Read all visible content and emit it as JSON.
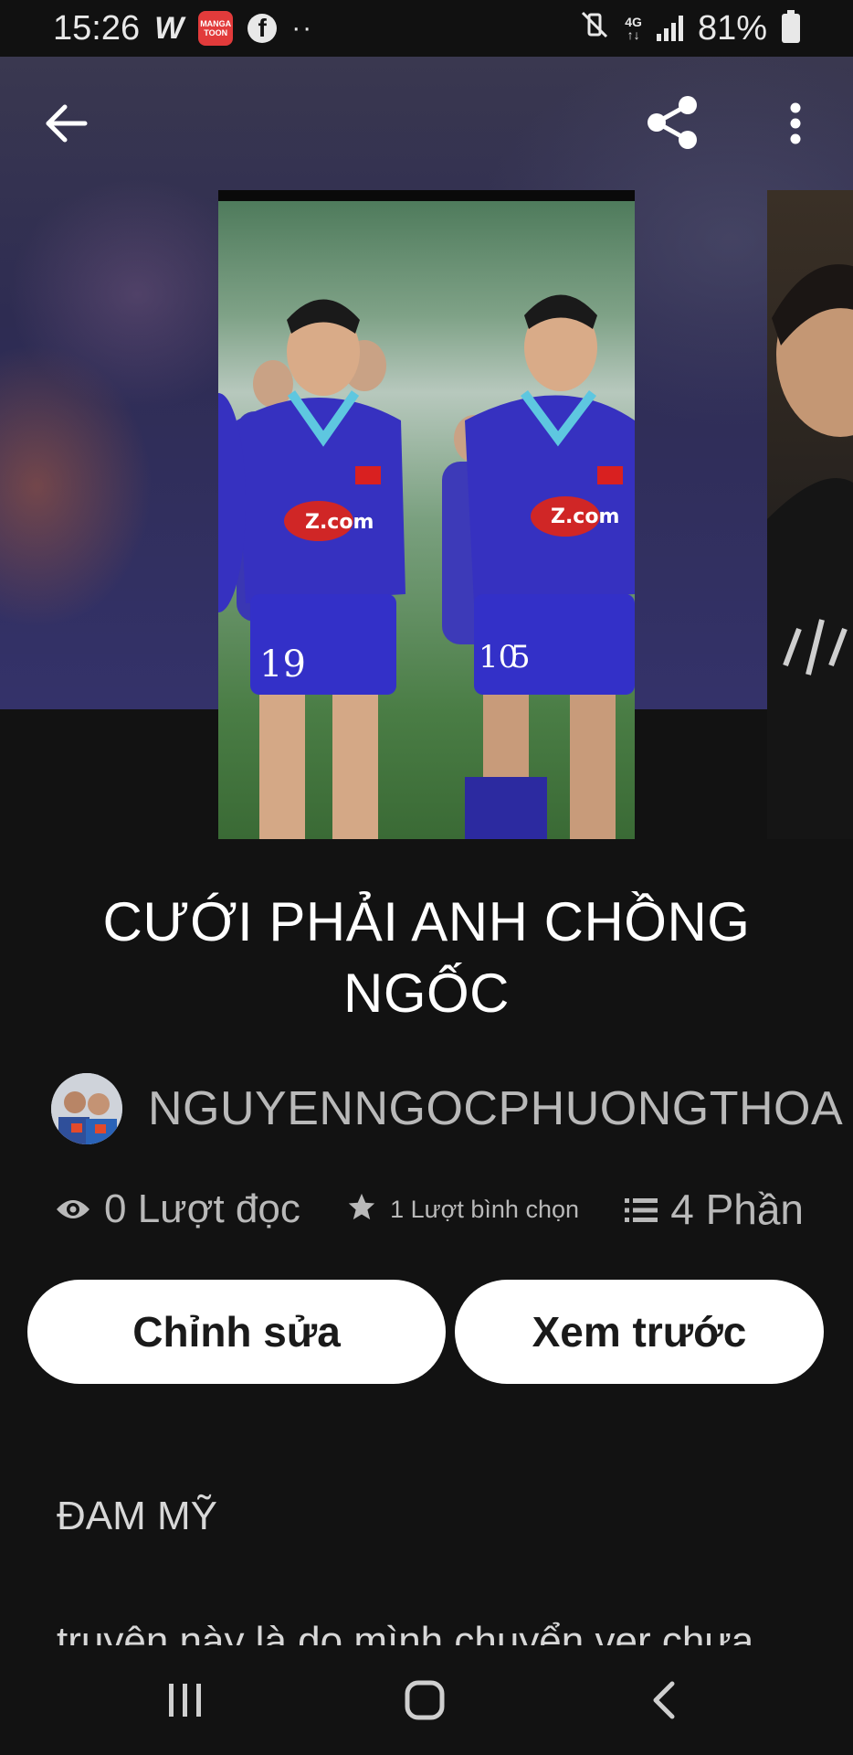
{
  "status_bar": {
    "time": "15:26",
    "app_w": "W",
    "manga_line1": "MANGA",
    "manga_line2": "TOON",
    "fb": "f",
    "dots": "··",
    "network_top": "4G",
    "network_bottom": "↑↓",
    "battery": "81%"
  },
  "story": {
    "title": "CƯỚI PHẢI ANH CHỒNG NGỐC",
    "author": "NGUYENNGOCPHUONGTHOA",
    "stats": {
      "reads": "0 Lượt đọc",
      "votes": "1 Lượt bình chọn",
      "parts": "4 Phần"
    },
    "tag": "ĐAM MỸ",
    "description": "truyện này là do mình chuyển ver chưa"
  },
  "cover": {
    "jersey_left": "19",
    "jersey_right": "5",
    "jersey_back": "10",
    "sponsor": "Z.com"
  },
  "actions": {
    "edit": "Chỉnh sửa",
    "preview": "Xem trước"
  },
  "icons": {
    "back": "arrow-left-icon",
    "share": "share-icon",
    "more": "more-vertical-icon",
    "eye": "eye-icon",
    "star": "star-icon",
    "list": "list-icon"
  }
}
